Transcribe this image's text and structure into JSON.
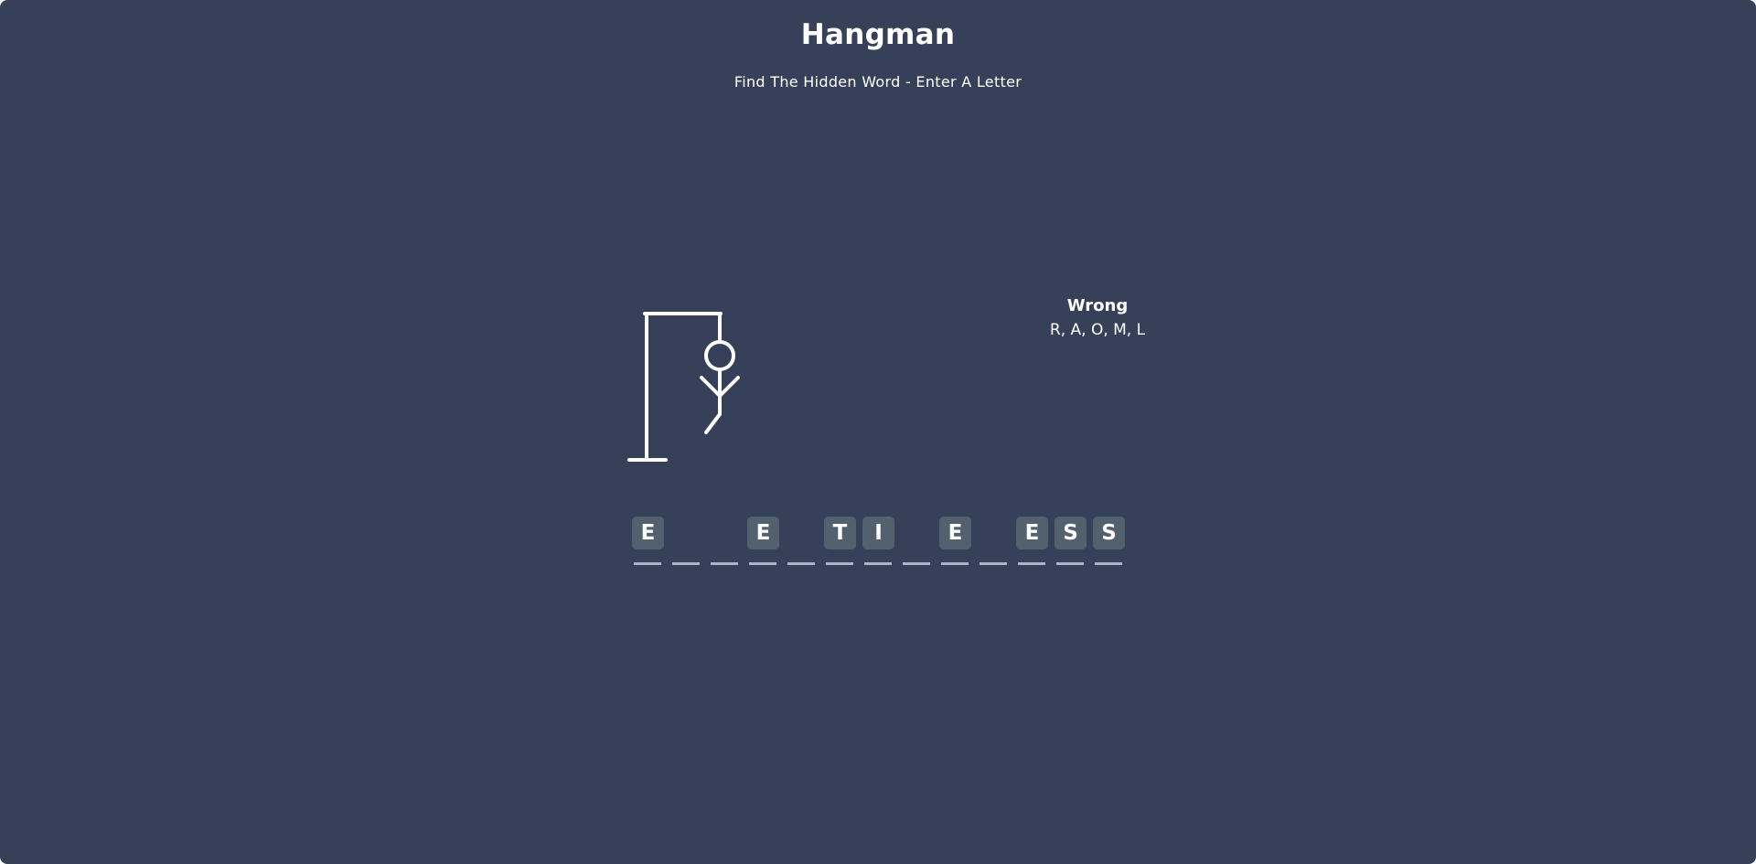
{
  "header": {
    "title": "Hangman",
    "subtitle": "Find The Hidden Word - Enter A Letter"
  },
  "wrong": {
    "title": "Wrong",
    "letters": "R, A, O, M, L"
  },
  "word": {
    "slots": [
      "E",
      "",
      "",
      "E",
      "",
      "T",
      "I",
      "",
      "E",
      "",
      "E",
      "S",
      "S"
    ]
  },
  "figure": {
    "parts_drawn": [
      "head",
      "body",
      "left-arm",
      "right-arm",
      "left-leg"
    ]
  },
  "colors": {
    "background": "#364059",
    "tile": "#53606e",
    "underline": "#aab3c7",
    "text": "#ffffff"
  }
}
